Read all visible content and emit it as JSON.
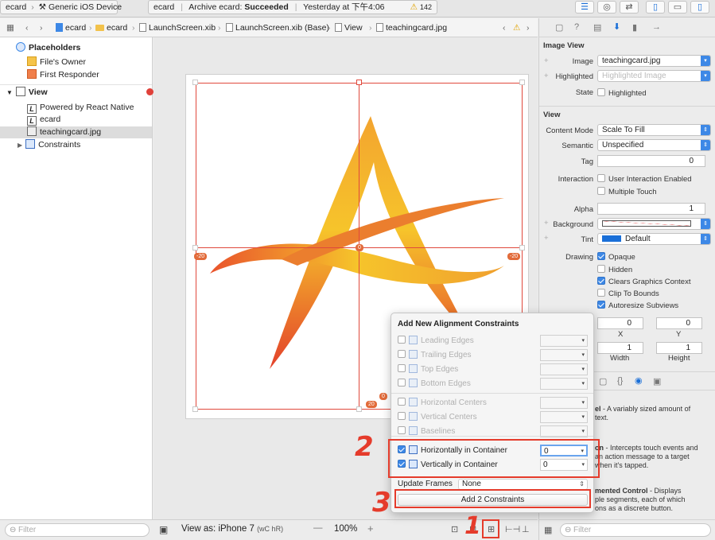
{
  "toolbar": {
    "scheme": "ecard",
    "device": "Generic iOS Device",
    "activity_project": "ecard",
    "activity_status_prefix": "Archive ecard:",
    "activity_status": "Succeeded",
    "activity_time": "Yesterday at 下午4:06",
    "warning_count": "142"
  },
  "pathbar": {
    "items": [
      "ecard",
      "ecard",
      "LaunchScreen.xib",
      "LaunchScreen.xib (Base)",
      "View",
      "teachingcard.jpg"
    ]
  },
  "outline": {
    "placeholders_label": "Placeholders",
    "files_owner": "File's Owner",
    "first_responder": "First Responder",
    "view_label": "View",
    "children": [
      "Powered by React Native",
      "ecard",
      "teachingcard.jpg"
    ],
    "constraints_label": "Constraints",
    "filter_placeholder": "Filter"
  },
  "canvas": {
    "view_as": "View as: iPhone 7",
    "size_class": "(wC hR)",
    "zoom": "100%",
    "zoom_minus": "—",
    "zoom_plus": "+",
    "constraint_badges": [
      "-20",
      "-20",
      "0",
      "20",
      "0"
    ]
  },
  "popover": {
    "title": "Add New Alignment Constraints",
    "options": [
      {
        "label": "Leading Edges",
        "enabled": false,
        "checked": false,
        "value": ""
      },
      {
        "label": "Trailing Edges",
        "enabled": false,
        "checked": false,
        "value": ""
      },
      {
        "label": "Top Edges",
        "enabled": false,
        "checked": false,
        "value": ""
      },
      {
        "label": "Bottom Edges",
        "enabled": false,
        "checked": false,
        "value": ""
      },
      {
        "label": "Horizontal Centers",
        "enabled": false,
        "checked": false,
        "value": ""
      },
      {
        "label": "Vertical Centers",
        "enabled": false,
        "checked": false,
        "value": ""
      },
      {
        "label": "Baselines",
        "enabled": false,
        "checked": false,
        "value": ""
      },
      {
        "label": "Horizontally in Container",
        "enabled": true,
        "checked": true,
        "value": "0"
      },
      {
        "label": "Vertically in Container",
        "enabled": true,
        "checked": true,
        "value": "0"
      }
    ],
    "update_frames_label": "Update Frames",
    "update_frames_value": "None",
    "add_button": "Add 2 Constraints"
  },
  "annotations": {
    "one": "1",
    "two": "2",
    "three": "3"
  },
  "inspector": {
    "image_view_header": "Image View",
    "image_label": "Image",
    "image_value": "teachingcard.jpg",
    "highlighted_label": "Highlighted",
    "highlighted_placeholder": "Highlighted Image",
    "state_label": "State",
    "state_highlighted": "Highlighted",
    "view_header": "View",
    "content_mode_label": "Content Mode",
    "content_mode_value": "Scale To Fill",
    "semantic_label": "Semantic",
    "semantic_value": "Unspecified",
    "tag_label": "Tag",
    "tag_value": "0",
    "interaction_label": "Interaction",
    "user_interaction": "User Interaction Enabled",
    "multiple_touch": "Multiple Touch",
    "alpha_label": "Alpha",
    "alpha_value": "1",
    "background_label": "Background",
    "tint_label": "Tint",
    "tint_value": "Default",
    "drawing_label": "Drawing",
    "opaque": "Opaque",
    "hidden": "Hidden",
    "clears_graphics": "Clears Graphics Context",
    "clip_to_bounds": "Clip To Bounds",
    "autoresize": "Autoresize Subviews",
    "x_value": "0",
    "y_value": "0",
    "x_label": "X",
    "y_label": "Y",
    "width_value": "1",
    "height_value": "1",
    "width_label": "Width",
    "height_label": "Height",
    "lib_1_title": "el",
    "lib_1_text": " - A variably sized amount of",
    "lib_1_text2": "text.",
    "lib_2_title": "on",
    "lib_2_text": " - Intercepts touch events and",
    "lib_2_text2": "an action message to a target",
    "lib_2_text3": "when it's tapped.",
    "lib_3_title": "mented Control",
    "lib_3_text": " - Displays",
    "lib_3_text2": "ple segments, each of which",
    "lib_3_text3": "ons as a discrete button.",
    "filter_placeholder": "Filter"
  },
  "colors": {
    "accent": "#3d88e6",
    "annotation": "#e53b2b",
    "logo_start": "#f6c42b",
    "logo_end": "#e3412b"
  }
}
